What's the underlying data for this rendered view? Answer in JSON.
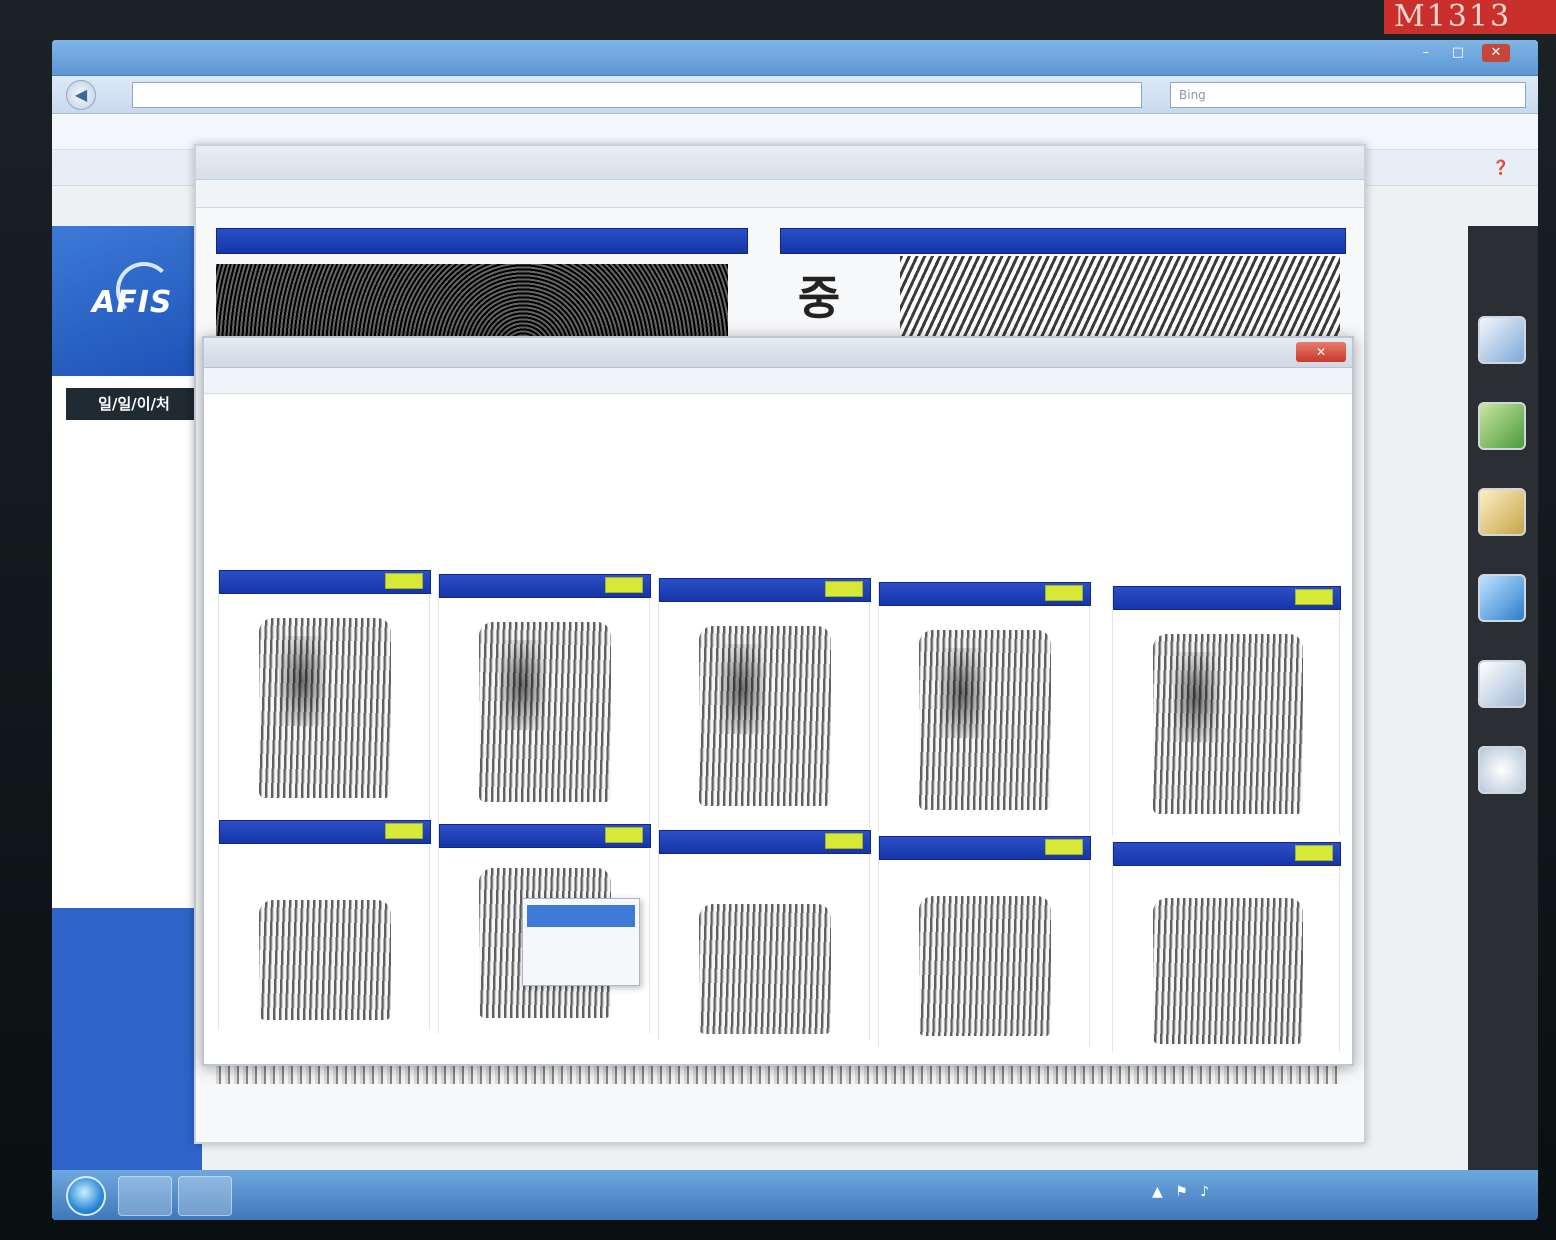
{
  "corner_badge": "M1313",
  "browser": {
    "tab_title": "",
    "url": "",
    "search_placeholder": "Bing",
    "menu_text": "",
    "favorites_text": ""
  },
  "afis": {
    "logo": "AFIS",
    "nav_title": "일/일/이/처",
    "nav_items": [
      "",
      "",
      "",
      ""
    ]
  },
  "popup_back": {
    "banner_left": "",
    "banner_right": "",
    "glyph": "중",
    "status": ""
  },
  "popup_front": {
    "title": "",
    "address": "",
    "heading": "",
    "info": [
      {
        "k": "",
        "v": ""
      },
      {
        "k": "",
        "v": ""
      },
      {
        "k": "",
        "v": ""
      },
      {
        "k": "",
        "v": ""
      },
      {
        "k": "",
        "v": ""
      },
      {
        "k": "",
        "v": ""
      },
      {
        "k": "",
        "v": ""
      }
    ],
    "fingers_row1": [
      {
        "header": "",
        "button": ""
      },
      {
        "header": "",
        "button": ""
      },
      {
        "header": "",
        "button": ""
      },
      {
        "header": "",
        "button": ""
      },
      {
        "header": "",
        "button": ""
      }
    ],
    "fingers_row2": [
      {
        "header": "",
        "button": ""
      },
      {
        "header": "",
        "button": ""
      },
      {
        "header": "",
        "button": ""
      },
      {
        "header": "",
        "button": ""
      },
      {
        "header": "",
        "button": ""
      }
    ],
    "context_menu": [
      "",
      "",
      ""
    ]
  },
  "taskbar": {
    "clock": ""
  },
  "colors": {
    "header_blue": "#1535a8",
    "cell_button_yellow": "#d8e836",
    "afis_blue": "#2e63c8"
  }
}
